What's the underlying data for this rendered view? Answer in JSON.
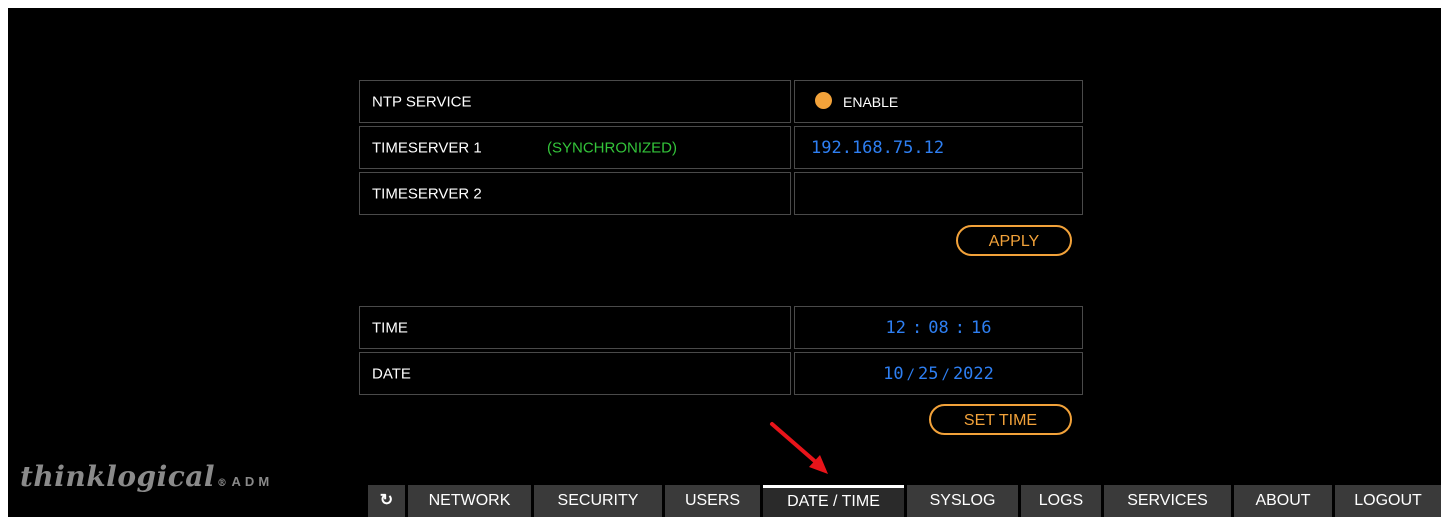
{
  "ntp": {
    "service_label": "NTP SERVICE",
    "enable_label": "ENABLE",
    "enable_selected": true,
    "timeserver1_label": "TIMESERVER 1",
    "timeserver1_status": "(SYNCHRONIZED)",
    "timeserver1_value": "192.168.75.12",
    "timeserver2_label": "TIMESERVER 2",
    "timeserver2_value": "",
    "apply_label": "APPLY"
  },
  "clock": {
    "time_label": "TIME",
    "hours": "12",
    "minutes": "08",
    "seconds": "16",
    "time_sep": ":",
    "date_label": "DATE",
    "month": "10",
    "day": "25",
    "year": "2022",
    "date_sep": "/",
    "set_time_label": "SET TIME"
  },
  "brand": {
    "logo_text": "thinklogical",
    "logo_reg": "®",
    "logo_suffix": "ADM"
  },
  "nav": {
    "refresh_icon": "↻",
    "tabs": [
      "NETWORK",
      "SECURITY",
      "USERS",
      "DATE / TIME",
      "SYSLOG",
      "LOGS",
      "SERVICES",
      "ABOUT",
      "LOGOUT"
    ],
    "active": "DATE / TIME"
  },
  "colors": {
    "accent": "#f2a23a",
    "value": "#2e7ff2",
    "status_ok": "#33c43a",
    "annotation_arrow": "#e8141a"
  }
}
